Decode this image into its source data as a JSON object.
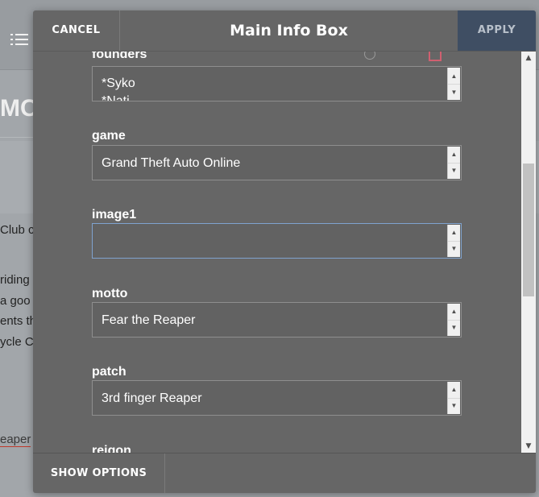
{
  "background": {
    "page_title": "MC",
    "text_lines": [
      "Club c",
      "riding",
      "a goo",
      "ents th",
      "ycle C",
      "eaper"
    ]
  },
  "dialog": {
    "cancel_label": "CANCEL",
    "title": "Main Info Box",
    "apply_label": "APPLY",
    "show_options_label": "SHOW OPTIONS",
    "fields": {
      "founders": {
        "label": "founders",
        "value_line1": "*Syko",
        "value_line2": "*Nati"
      },
      "game": {
        "label": "game",
        "value": "Grand Theft Auto Online"
      },
      "image1": {
        "label": "image1",
        "value": ""
      },
      "motto": {
        "label": "motto",
        "value": "Fear the Reaper"
      },
      "patch": {
        "label": "patch",
        "value": "3rd finger Reaper"
      },
      "reigon": {
        "label": "reigon"
      }
    }
  },
  "colors": {
    "dialog_bg": "#666666",
    "apply_bg": "#3f4e63",
    "focus_border": "#7fa3cf"
  }
}
